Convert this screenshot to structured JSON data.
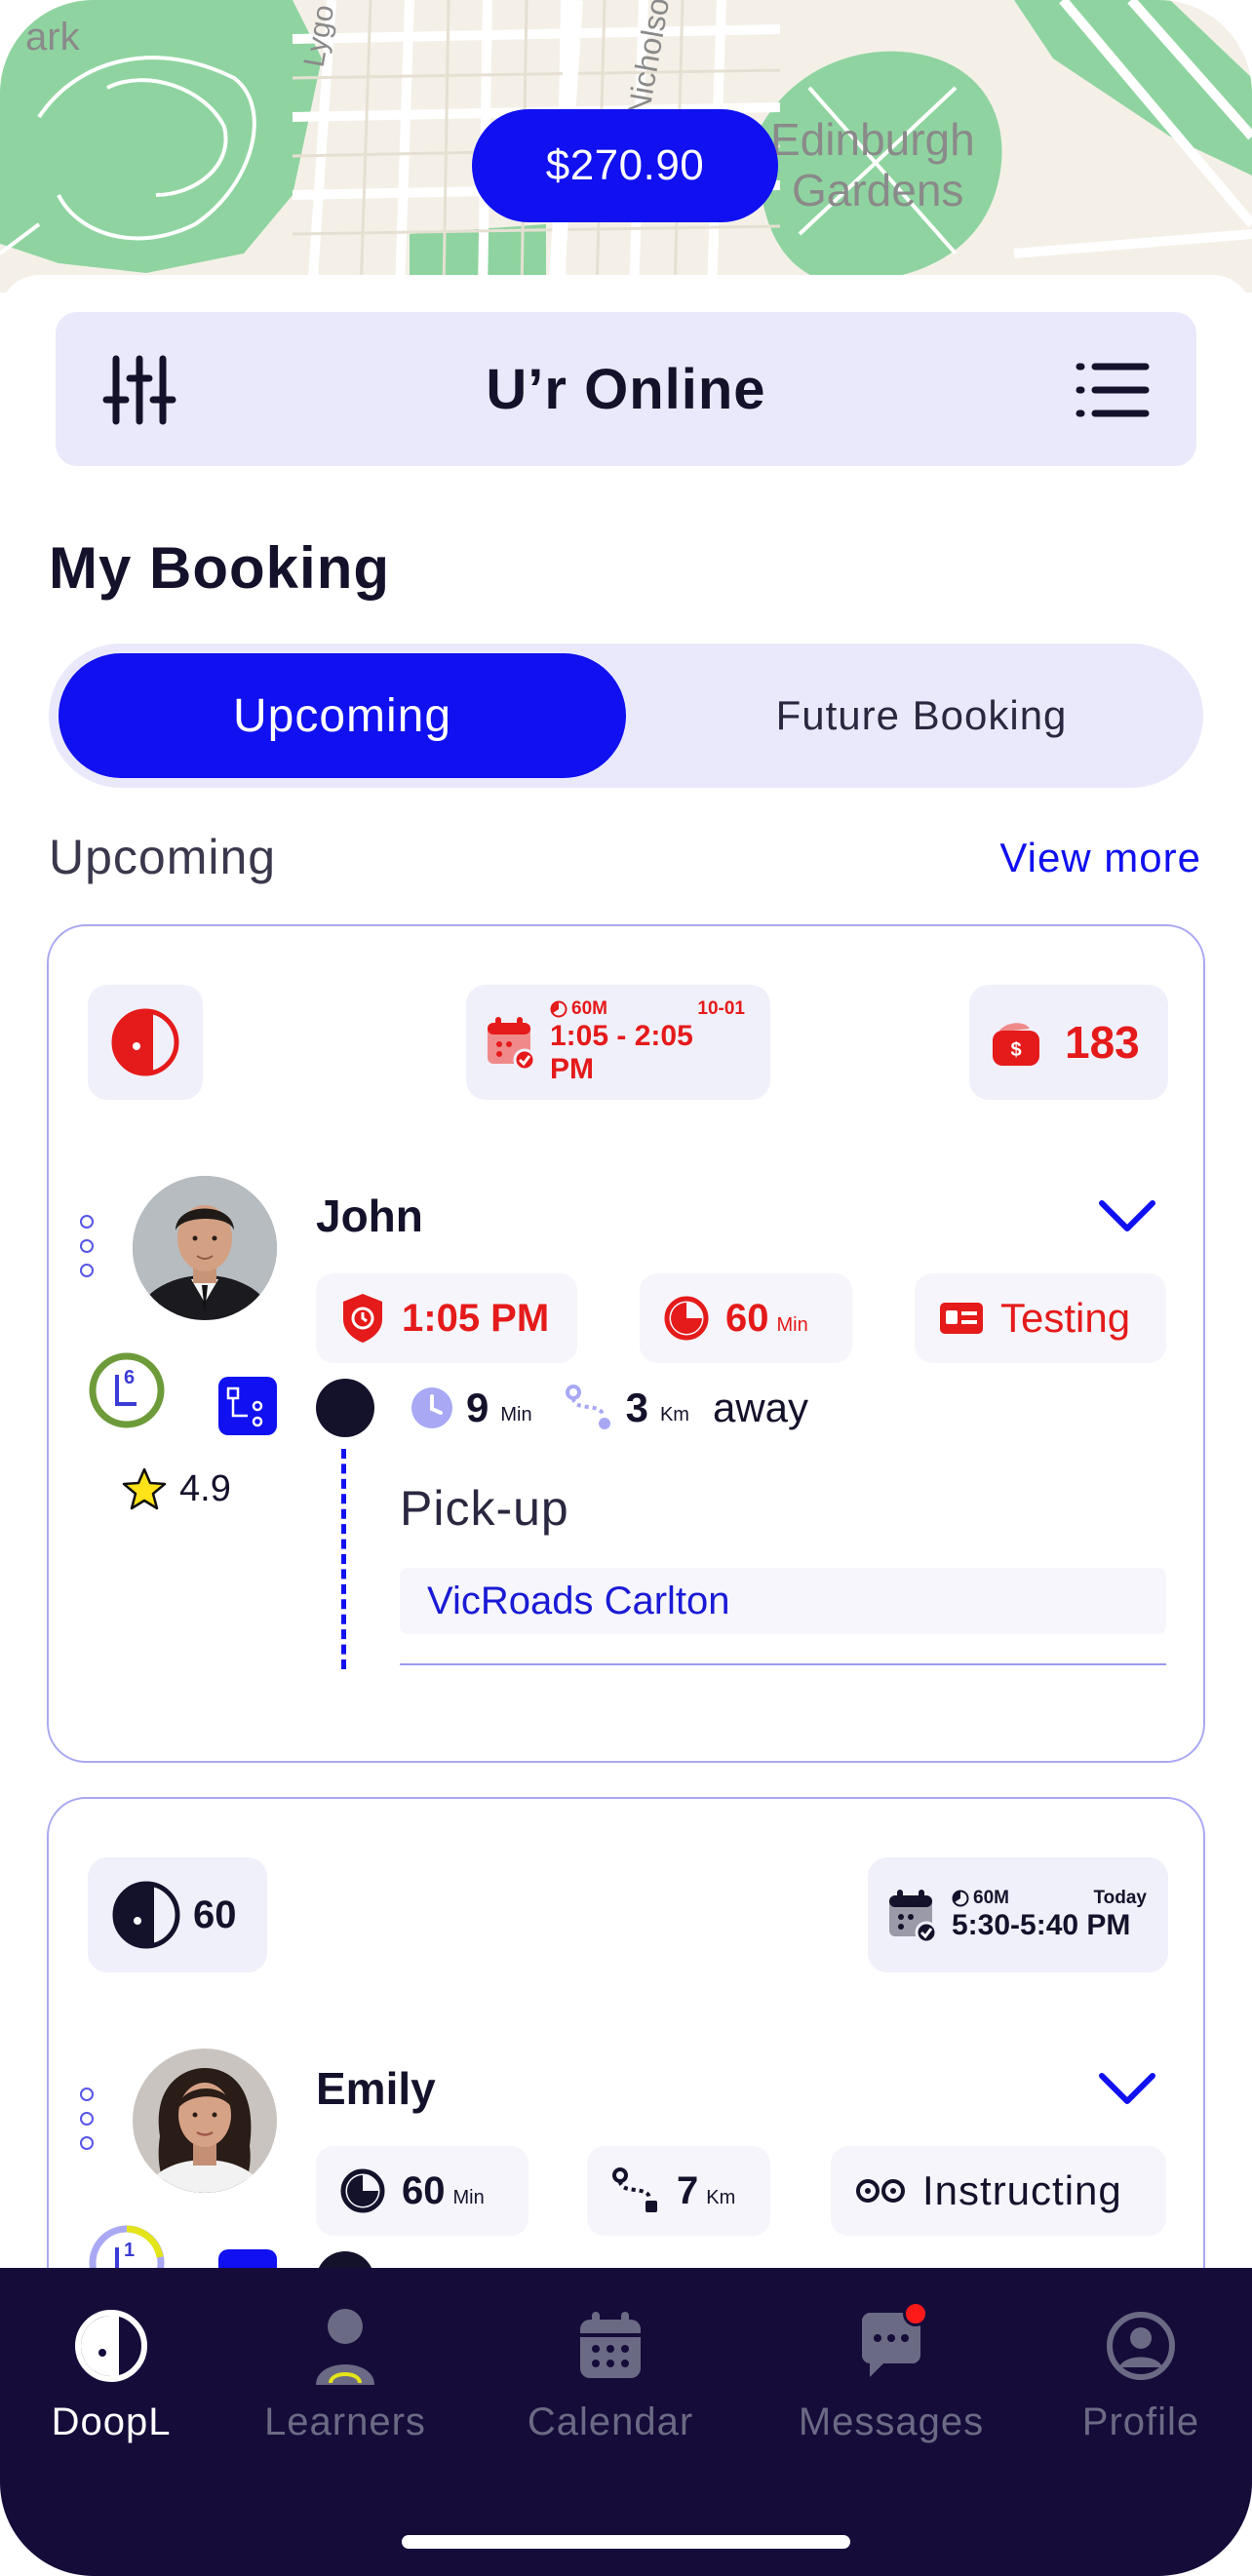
{
  "map": {
    "place_labels": [
      "ark",
      "Lygo",
      "Nicholso",
      "Edinburgh",
      "Gardens"
    ],
    "balance": "$270.90"
  },
  "header": {
    "title": "U’r Online"
  },
  "booking": {
    "heading": "My Booking",
    "tabs": [
      {
        "label": "Upcoming",
        "active": true
      },
      {
        "label": "Future Booking",
        "active": false
      }
    ],
    "section_title": "Upcoming",
    "view_more": "View more"
  },
  "cards": [
    {
      "time_chip": {
        "duration": "60M",
        "date": "10-01",
        "range": "1:05 - 2:05 PM"
      },
      "count": "183",
      "name": "John",
      "pills": [
        {
          "value": "1:05 PM",
          "unit": ""
        },
        {
          "value": "60",
          "unit": "Min"
        },
        {
          "value": "Testing",
          "unit": ""
        }
      ],
      "level_badge": "6",
      "rating": "4.9",
      "eta": {
        "minutes": "9",
        "minutes_unit": "Min",
        "distance": "3",
        "distance_unit": "Km",
        "suffix": "away"
      },
      "pickup_label": "Pick-up",
      "pickup_address": "VicRoads Carlton"
    },
    {
      "lesson_count": "60",
      "time_chip": {
        "duration": "60M",
        "date": "Today",
        "range": "5:30-5:40 PM"
      },
      "name": "Emily",
      "pills": [
        {
          "value": "60",
          "unit": "Min"
        },
        {
          "value": "7",
          "unit": "Km"
        },
        {
          "value": "Instructing",
          "unit": ""
        }
      ],
      "level_badge": "1"
    }
  ],
  "nav": {
    "items": [
      {
        "label": "DoopL",
        "icon": "doopl-logo-icon",
        "active": true
      },
      {
        "label": "Learners",
        "icon": "learner-icon",
        "active": false
      },
      {
        "label": "Calendar",
        "icon": "calendar-icon",
        "active": false
      },
      {
        "label": "Messages",
        "icon": "chat-icon",
        "active": false,
        "badge": true
      },
      {
        "label": "Profile",
        "icon": "profile-icon",
        "active": false
      }
    ]
  },
  "colors": {
    "accent": "#1010f0",
    "alert": "#e51a1a",
    "nav_bg": "#150c3a",
    "surface": "#e9e9fb"
  }
}
